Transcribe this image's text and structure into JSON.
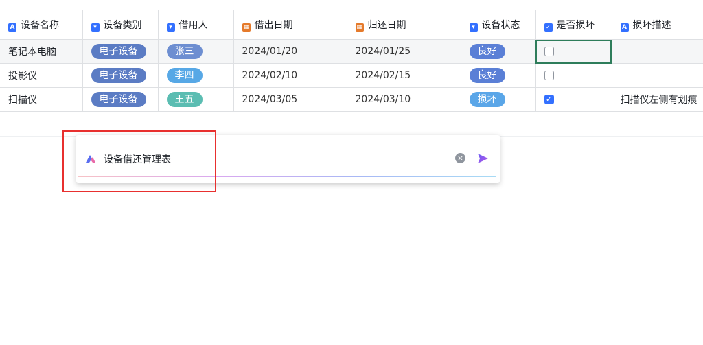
{
  "columns": [
    {
      "label": "设备名称",
      "icon": "A",
      "icon_color": "blue"
    },
    {
      "label": "设备类别",
      "icon": "▾",
      "icon_color": "blue"
    },
    {
      "label": "借用人",
      "icon": "▾",
      "icon_color": "blue"
    },
    {
      "label": "借出日期",
      "icon": "▦",
      "icon_color": "orange"
    },
    {
      "label": "归还日期",
      "icon": "▦",
      "icon_color": "orange"
    },
    {
      "label": "设备状态",
      "icon": "▾",
      "icon_color": "blue"
    },
    {
      "label": "是否损坏",
      "icon": "✓",
      "icon_color": "blue"
    },
    {
      "label": "损坏描述",
      "icon": "A",
      "icon_color": "blue"
    }
  ],
  "rows": [
    {
      "name": "笔记本电脑",
      "category": "电子设备",
      "borrower": "张三",
      "out_date": "2024/01/20",
      "return_date": "2024/01/25",
      "status": "良好",
      "damaged": false,
      "damage_desc": ""
    },
    {
      "name": "投影仪",
      "category": "电子设备",
      "borrower": "李四",
      "out_date": "2024/02/10",
      "return_date": "2024/02/15",
      "status": "良好",
      "damaged": false,
      "damage_desc": ""
    },
    {
      "name": "扫描仪",
      "category": "电子设备",
      "borrower": "王五",
      "out_date": "2024/03/05",
      "return_date": "2024/03/10",
      "status": "损坏",
      "damaged": true,
      "damage_desc": "扫描仪左侧有划痕"
    }
  ],
  "ai_input": {
    "value": "设备借还管理表",
    "clear_icon": "clear-icon",
    "send_icon": "send-icon",
    "logo_icon": "ai-logo-icon"
  },
  "colors": {
    "accent": "#3370ff",
    "highlight_border": "#e8302f",
    "selected_cell_border": "#2e7d5b"
  }
}
